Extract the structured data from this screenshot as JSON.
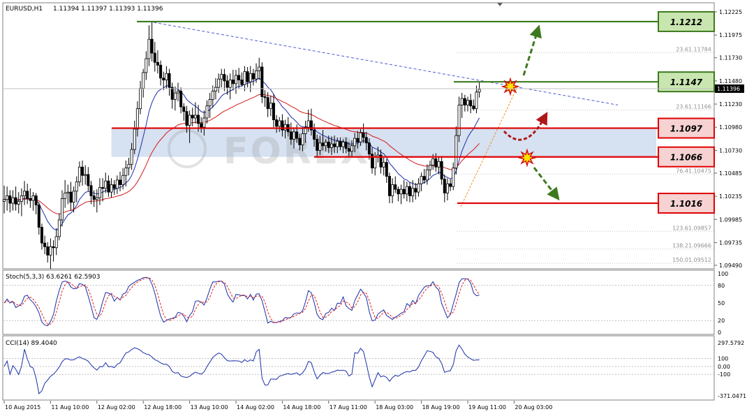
{
  "header": {
    "symbol": "EURUSD,H1",
    "ohlc": "1.11394 1.11397 1.11393 1.11396"
  },
  "chart_data": {
    "type": "candlestick",
    "price_axis": {
      "ticks": [
        "1.12225",
        "1.11975",
        "1.11730",
        "1.11480",
        "1.11230",
        "1.10980",
        "1.10730",
        "1.10485",
        "1.10235",
        "1.09985",
        "1.09735",
        "1.09490"
      ],
      "current_price": "1.11396",
      "ylim": [
        1.0949,
        1.12225
      ]
    },
    "time_labels": [
      "10 Aug 2015",
      "11 Aug 10:00",
      "12 Aug 02:00",
      "12 Aug 18:00",
      "13 Aug 10:00",
      "14 Aug 02:00",
      "14 Aug 18:00",
      "17 Aug 11:00",
      "18 Aug 03:00",
      "18 Aug 19:00",
      "19 Aug 11:00",
      "20 Aug 03:00"
    ],
    "levels": [
      {
        "label": "1.1212",
        "value": 1.1212,
        "color": "#3d7a1e",
        "fill": "#c9e6b0"
      },
      {
        "label": "1.1147",
        "value": 1.1147,
        "color": "#3d7a1e",
        "fill": "#c9e6b0"
      },
      {
        "label": "1.1097",
        "value": 1.1097,
        "color": "#e00000",
        "fill": "#f6d2d2"
      },
      {
        "label": "1.1066",
        "value": 1.1066,
        "color": "#e00000",
        "fill": "#f6d2d2"
      },
      {
        "label": "1.1016",
        "value": 1.1016,
        "color": "#e00000",
        "fill": "#f6d2d2"
      }
    ],
    "fib_levels": [
      {
        "ratio": "23.6",
        "value": "1.11784"
      },
      {
        "ratio": "23.6",
        "value": "1.11166"
      },
      {
        "ratio": "76.4",
        "value": "1.10475"
      },
      {
        "ratio": "123.6",
        "value": "1.09857"
      },
      {
        "ratio": "138.2",
        "value": "1.09666"
      },
      {
        "ratio": "150.0",
        "value": "1.09512"
      }
    ],
    "watermark": "FOREX",
    "candles": [
      [
        1.1018,
        1.1035,
        1.1005,
        1.102
      ],
      [
        1.102,
        1.1034,
        1.1008,
        1.1024
      ],
      [
        1.1024,
        1.103,
        1.1006,
        1.1016
      ],
      [
        1.1016,
        1.103,
        1.1008,
        1.1022
      ],
      [
        1.1022,
        1.1034,
        1.1008,
        1.1015
      ],
      [
        1.1015,
        1.1028,
        1.1005,
        1.1018
      ],
      [
        1.1018,
        1.1032,
        1.1002,
        1.1024
      ],
      [
        1.1024,
        1.104,
        1.1014,
        1.1029
      ],
      [
        1.1029,
        1.1037,
        1.1015,
        1.1021
      ],
      [
        1.1021,
        1.1032,
        1.1011,
        1.1019
      ],
      [
        1.1019,
        1.1028,
        1.1008,
        1.1024
      ],
      [
        1.1024,
        1.1027,
        1.1004,
        1.1014
      ],
      [
        1.1014,
        1.1017,
        1.0982,
        1.099
      ],
      [
        1.099,
        1.0994,
        1.0966,
        1.0973
      ],
      [
        1.0973,
        1.0981,
        1.0961,
        1.0969
      ],
      [
        1.0969,
        1.0974,
        1.0952,
        1.096
      ],
      [
        1.096,
        1.0978,
        1.0945,
        1.0969
      ],
      [
        1.0969,
        1.0976,
        1.0953,
        1.0968
      ],
      [
        1.0968,
        1.0989,
        1.096,
        1.098
      ],
      [
        1.098,
        1.1005,
        1.0976,
        1.0998
      ],
      [
        1.0998,
        1.103,
        1.0991,
        1.1021
      ],
      [
        1.1021,
        1.1041,
        1.1011,
        1.1027
      ],
      [
        1.1027,
        1.1036,
        1.1015,
        1.1028
      ],
      [
        1.1028,
        1.1039,
        1.1008,
        1.1017
      ],
      [
        1.1017,
        1.1034,
        1.1006,
        1.1029
      ],
      [
        1.1029,
        1.1045,
        1.1017,
        1.1039
      ],
      [
        1.1039,
        1.1061,
        1.1034,
        1.1055
      ],
      [
        1.1055,
        1.1062,
        1.1035,
        1.1046
      ],
      [
        1.1046,
        1.1057,
        1.1036,
        1.1047
      ],
      [
        1.1047,
        1.1055,
        1.1029,
        1.1035
      ],
      [
        1.1035,
        1.104,
        1.1015,
        1.1024
      ],
      [
        1.1024,
        1.103,
        1.1012,
        1.102
      ],
      [
        1.102,
        1.1031,
        1.1006,
        1.1022
      ],
      [
        1.1022,
        1.1043,
        1.1014,
        1.1033
      ],
      [
        1.1033,
        1.1043,
        1.1018,
        1.1032
      ],
      [
        1.1032,
        1.1049,
        1.1027,
        1.104
      ],
      [
        1.104,
        1.1046,
        1.1023,
        1.1028
      ],
      [
        1.1028,
        1.1043,
        1.1022,
        1.1036
      ],
      [
        1.1036,
        1.1041,
        1.1025,
        1.1032
      ],
      [
        1.1032,
        1.1046,
        1.1026,
        1.1041
      ],
      [
        1.1041,
        1.105,
        1.1029,
        1.1036
      ],
      [
        1.1036,
        1.1054,
        1.1031,
        1.1046
      ],
      [
        1.1046,
        1.1062,
        1.1034,
        1.1054
      ],
      [
        1.1054,
        1.1065,
        1.1046,
        1.1058
      ],
      [
        1.1058,
        1.1081,
        1.1052,
        1.1074
      ],
      [
        1.1074,
        1.1105,
        1.1069,
        1.1096
      ],
      [
        1.1096,
        1.1126,
        1.1088,
        1.1118
      ],
      [
        1.1118,
        1.1148,
        1.1112,
        1.114
      ],
      [
        1.114,
        1.1161,
        1.113,
        1.1157
      ],
      [
        1.1157,
        1.118,
        1.1149,
        1.1172
      ],
      [
        1.1172,
        1.1208,
        1.1164,
        1.1193
      ],
      [
        1.1193,
        1.1212,
        1.1169,
        1.1178
      ],
      [
        1.1178,
        1.119,
        1.1158,
        1.1168
      ],
      [
        1.1168,
        1.1181,
        1.1156,
        1.1165
      ],
      [
        1.1165,
        1.117,
        1.1143,
        1.1151
      ],
      [
        1.1151,
        1.1158,
        1.1138,
        1.1149
      ],
      [
        1.1149,
        1.1164,
        1.114,
        1.1156
      ],
      [
        1.1156,
        1.1161,
        1.1132,
        1.1141
      ],
      [
        1.1141,
        1.1146,
        1.1118,
        1.1128
      ],
      [
        1.1128,
        1.1142,
        1.1116,
        1.1135
      ],
      [
        1.1135,
        1.1146,
        1.1126,
        1.1137
      ],
      [
        1.1137,
        1.1141,
        1.1113,
        1.112
      ],
      [
        1.112,
        1.1124,
        1.1105,
        1.1115
      ],
      [
        1.1115,
        1.1121,
        1.1092,
        1.11
      ],
      [
        1.11,
        1.1116,
        1.1081,
        1.1111
      ],
      [
        1.1111,
        1.1119,
        1.1099,
        1.1108
      ],
      [
        1.1108,
        1.1125,
        1.1102,
        1.1111
      ],
      [
        1.1111,
        1.1122,
        1.1093,
        1.1102
      ],
      [
        1.1102,
        1.1109,
        1.1092,
        1.1098
      ],
      [
        1.1098,
        1.1116,
        1.1089,
        1.1108
      ],
      [
        1.1108,
        1.1127,
        1.1102,
        1.1121
      ],
      [
        1.1121,
        1.1135,
        1.1108,
        1.1128
      ],
      [
        1.1128,
        1.1143,
        1.1119,
        1.1137
      ],
      [
        1.1137,
        1.1151,
        1.1128,
        1.1141
      ],
      [
        1.1141,
        1.1156,
        1.1135,
        1.115
      ],
      [
        1.115,
        1.1161,
        1.1141,
        1.1155
      ],
      [
        1.1155,
        1.1161,
        1.1137,
        1.1148
      ],
      [
        1.1148,
        1.1154,
        1.1133,
        1.1141
      ],
      [
        1.1141,
        1.1156,
        1.1128,
        1.1149
      ],
      [
        1.1149,
        1.116,
        1.1138,
        1.1145
      ],
      [
        1.1145,
        1.116,
        1.1134,
        1.1154
      ],
      [
        1.1154,
        1.1162,
        1.114,
        1.1149
      ],
      [
        1.1149,
        1.1157,
        1.1142,
        1.1144
      ],
      [
        1.1144,
        1.1164,
        1.1137,
        1.1158
      ],
      [
        1.1158,
        1.1163,
        1.1141,
        1.1147
      ],
      [
        1.1147,
        1.1164,
        1.1136,
        1.1156
      ],
      [
        1.1156,
        1.1161,
        1.1143,
        1.115
      ],
      [
        1.115,
        1.1167,
        1.1146,
        1.1159
      ],
      [
        1.1159,
        1.1173,
        1.1149,
        1.1163
      ],
      [
        1.1163,
        1.1168,
        1.1124,
        1.1131
      ],
      [
        1.1131,
        1.1138,
        1.112,
        1.113
      ],
      [
        1.113,
        1.1136,
        1.1109,
        1.1118
      ],
      [
        1.1118,
        1.1132,
        1.111,
        1.1124
      ],
      [
        1.1124,
        1.1134,
        1.1098,
        1.1106
      ],
      [
        1.1106,
        1.1111,
        1.1092,
        1.1099
      ],
      [
        1.1099,
        1.1109,
        1.1093,
        1.1105
      ],
      [
        1.1105,
        1.1112,
        1.1088,
        1.1095
      ],
      [
        1.1095,
        1.1106,
        1.1086,
        1.1101
      ],
      [
        1.1101,
        1.1109,
        1.1088,
        1.1093
      ],
      [
        1.1093,
        1.1103,
        1.1079,
        1.1085
      ],
      [
        1.1085,
        1.1098,
        1.1075,
        1.1093
      ],
      [
        1.1093,
        1.1101,
        1.1081,
        1.1086
      ],
      [
        1.1086,
        1.1091,
        1.1073,
        1.1079
      ],
      [
        1.1079,
        1.1098,
        1.1072,
        1.1091
      ],
      [
        1.1091,
        1.1105,
        1.1081,
        1.1098
      ],
      [
        1.1098,
        1.1117,
        1.1093,
        1.1105
      ],
      [
        1.1105,
        1.1118,
        1.1089,
        1.1095
      ],
      [
        1.1095,
        1.1102,
        1.1077,
        1.1085
      ],
      [
        1.1085,
        1.109,
        1.1066,
        1.1073
      ],
      [
        1.1073,
        1.1089,
        1.1068,
        1.1081
      ],
      [
        1.1081,
        1.1095,
        1.1073,
        1.1078
      ],
      [
        1.1078,
        1.1085,
        1.1072,
        1.1082
      ],
      [
        1.1082,
        1.1089,
        1.107,
        1.1076
      ],
      [
        1.1076,
        1.1088,
        1.1068,
        1.108
      ],
      [
        1.108,
        1.1089,
        1.107,
        1.1077
      ],
      [
        1.1077,
        1.1087,
        1.107,
        1.1083
      ],
      [
        1.1083,
        1.1087,
        1.1073,
        1.1077
      ],
      [
        1.1077,
        1.1085,
        1.107,
        1.1082
      ],
      [
        1.1082,
        1.1087,
        1.107,
        1.1075
      ],
      [
        1.1075,
        1.1082,
        1.1066,
        1.1072
      ],
      [
        1.1072,
        1.1084,
        1.1066,
        1.1078
      ],
      [
        1.1078,
        1.1092,
        1.1071,
        1.1086
      ],
      [
        1.1086,
        1.1094,
        1.1075,
        1.1082
      ],
      [
        1.1082,
        1.1096,
        1.1078,
        1.1092
      ],
      [
        1.1092,
        1.1102,
        1.1081,
        1.1087
      ],
      [
        1.1087,
        1.1093,
        1.1073,
        1.1081
      ],
      [
        1.1081,
        1.1086,
        1.1063,
        1.1069
      ],
      [
        1.1069,
        1.1076,
        1.1048,
        1.1054
      ],
      [
        1.1054,
        1.1071,
        1.1046,
        1.1066
      ],
      [
        1.1066,
        1.1077,
        1.106,
        1.1068
      ],
      [
        1.1068,
        1.1074,
        1.1048,
        1.1055
      ],
      [
        1.1055,
        1.1065,
        1.1046,
        1.106
      ],
      [
        1.106,
        1.1064,
        1.1038,
        1.1045
      ],
      [
        1.1045,
        1.1049,
        1.1016,
        1.1024
      ],
      [
        1.1024,
        1.1043,
        1.1016,
        1.1036
      ],
      [
        1.1036,
        1.1045,
        1.1027,
        1.1031
      ],
      [
        1.1031,
        1.1034,
        1.1018,
        1.1026
      ],
      [
        1.1026,
        1.1036,
        1.1015,
        1.1031
      ],
      [
        1.1031,
        1.1041,
        1.1021,
        1.1026
      ],
      [
        1.1026,
        1.1039,
        1.1018,
        1.1034
      ],
      [
        1.1034,
        1.1039,
        1.1017,
        1.1024
      ],
      [
        1.1024,
        1.1041,
        1.1017,
        1.1032
      ],
      [
        1.1032,
        1.1038,
        1.102,
        1.1028
      ],
      [
        1.1028,
        1.1043,
        1.1023,
        1.1037
      ],
      [
        1.1037,
        1.1049,
        1.1029,
        1.1045
      ],
      [
        1.1045,
        1.1053,
        1.1037,
        1.1041
      ],
      [
        1.1041,
        1.1058,
        1.1036,
        1.1052
      ],
      [
        1.1052,
        1.1062,
        1.1045,
        1.1057
      ],
      [
        1.1057,
        1.1069,
        1.1052,
        1.1064
      ],
      [
        1.1064,
        1.107,
        1.105,
        1.1055
      ],
      [
        1.1055,
        1.1066,
        1.1047,
        1.1061
      ],
      [
        1.1061,
        1.1067,
        1.1036,
        1.1042
      ],
      [
        1.1042,
        1.1047,
        1.1017,
        1.1027
      ],
      [
        1.1027,
        1.1043,
        1.1019,
        1.1037
      ],
      [
        1.1037,
        1.1042,
        1.1029,
        1.1034
      ],
      [
        1.1034,
        1.106,
        1.103,
        1.1054
      ],
      [
        1.1054,
        1.1099,
        1.1047,
        1.1089
      ],
      [
        1.1089,
        1.1131,
        1.1082,
        1.1122
      ],
      [
        1.1122,
        1.1135,
        1.1108,
        1.1129
      ],
      [
        1.1129,
        1.1133,
        1.1115,
        1.1122
      ],
      [
        1.1122,
        1.1131,
        1.1115,
        1.1127
      ],
      [
        1.1127,
        1.1134,
        1.1113,
        1.1121
      ],
      [
        1.1121,
        1.1128,
        1.1116,
        1.1118
      ],
      [
        1.1118,
        1.1143,
        1.1113,
        1.1136
      ],
      [
        1.1136,
        1.1147,
        1.113,
        1.1139
      ]
    ]
  },
  "stoch": {
    "label": "Stoch(5,3,3) 63.6261 62.5903",
    "ticks": [
      "100",
      "80",
      "50",
      "20",
      "0"
    ]
  },
  "cci": {
    "label": "CCI(14) 89.4040",
    "ticks": [
      "297.5792",
      "100",
      "0.00",
      "-100",
      "-371.0471"
    ]
  }
}
